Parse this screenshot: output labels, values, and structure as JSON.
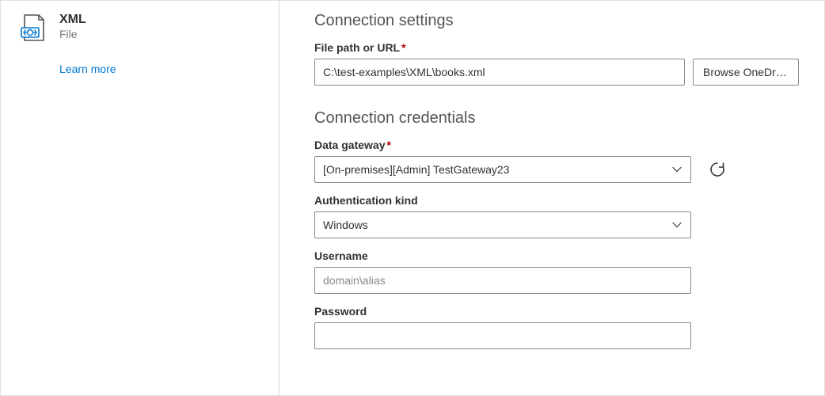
{
  "sidebar": {
    "title": "XML",
    "subtitle": "File",
    "learn_more": "Learn more"
  },
  "settings": {
    "heading": "Connection settings",
    "file_path_label": "File path or URL",
    "file_path_value": "C:\\test-examples\\XML\\books.xml",
    "browse_label": "Browse OneDrive..."
  },
  "credentials": {
    "heading": "Connection credentials",
    "gateway_label": "Data gateway",
    "gateway_value": "[On-premises][Admin] TestGateway23",
    "auth_label": "Authentication kind",
    "auth_value": "Windows",
    "username_label": "Username",
    "username_placeholder": "domain\\alias",
    "password_label": "Password"
  }
}
